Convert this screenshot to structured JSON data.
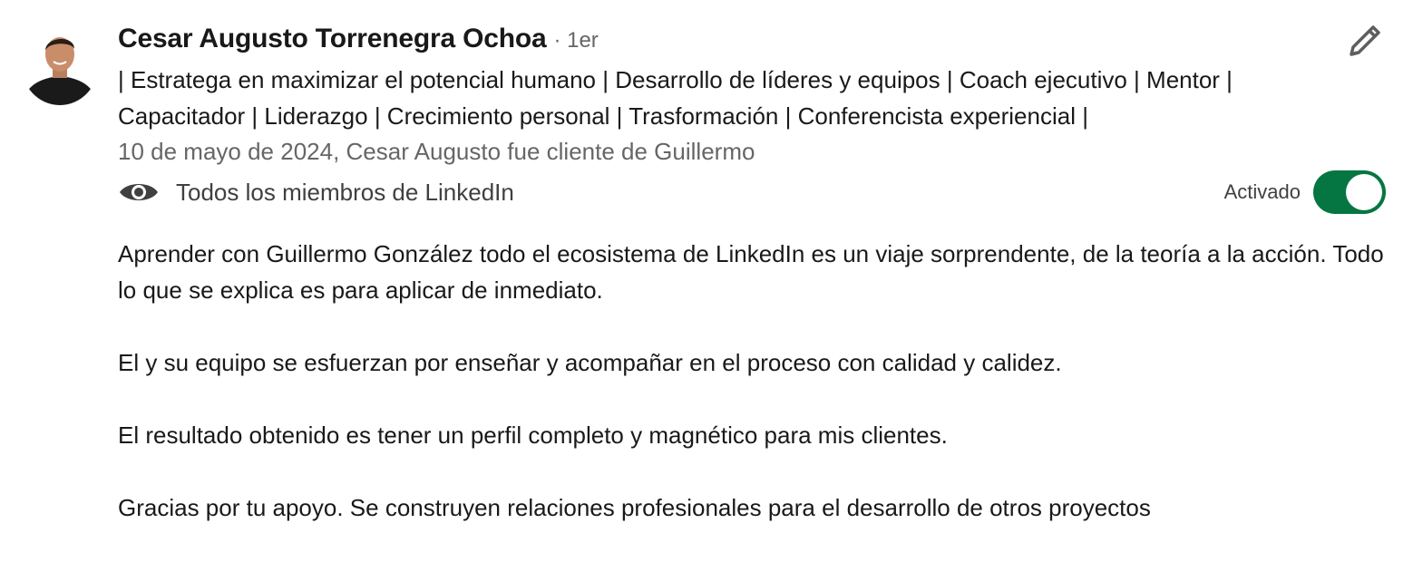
{
  "recommender": {
    "name": "Cesar Augusto Torrenegra Ochoa",
    "degree": "· 1er",
    "headline": "| Estratega en maximizar el potencial humano | Desarrollo de líderes y equipos | Coach ejecutivo | Mentor | Capacitador | Liderazgo | Crecimiento personal | Trasformación | Conferencista experiencial |",
    "meta": "10 de mayo de 2024, Cesar Augusto fue cliente de Guillermo"
  },
  "visibility": {
    "label": "Todos los miembros de LinkedIn",
    "icon": "eye-icon"
  },
  "toggle": {
    "label": "Activado",
    "on": true,
    "color": "#057642"
  },
  "actions": {
    "edit_icon": "pencil-icon"
  },
  "recommendation": {
    "paragraphs": [
      "Aprender con Guillermo González todo el ecosistema de LinkedIn es un viaje sorprendente, de la teoría a la acción. Todo lo que se explica es para aplicar de inmediato.",
      "El y su equipo se esfuerzan por enseñar y acompañar en el proceso con calidad y calidez.",
      "El resultado obtenido es tener un perfil completo y magnético para mis clientes.",
      "Gracias por tu apoyo. Se construyen relaciones profesionales para el desarrollo de otros proyectos"
    ]
  }
}
